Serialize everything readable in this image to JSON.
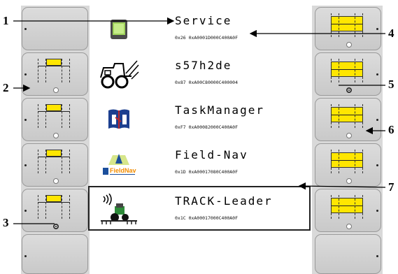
{
  "apps": [
    {
      "name": "Service",
      "id": "0x26 0xA0001D000C400A0F",
      "icon": "terminal-icon"
    },
    {
      "name": "s57h2de",
      "id": "0x87 0xA00C80000C400004",
      "icon": "sprayer-vehicle-icon"
    },
    {
      "name": "TaskManager",
      "id": "0xF7 0xA00082000C400A0F",
      "icon": "taskmanager-book-icon"
    },
    {
      "name": "Field-Nav",
      "id": "0x1D 0xA00017080C400A0F",
      "icon": "fieldnav-logo-icon",
      "logo_text": "FieldNav"
    },
    {
      "name": "TRACK-Leader",
      "id": "0x1C 0xA00017000C400A0F",
      "icon": "tractor-sprayer-icon"
    }
  ],
  "selected_app": "TRACK-Leader",
  "callouts": [
    "1",
    "2",
    "3",
    "4",
    "5",
    "6",
    "7"
  ],
  "colors": {
    "boom_yellow": "#ffe600",
    "softkey_gray": "#cfcfcf",
    "screen_bg": "#d9d9d9"
  }
}
